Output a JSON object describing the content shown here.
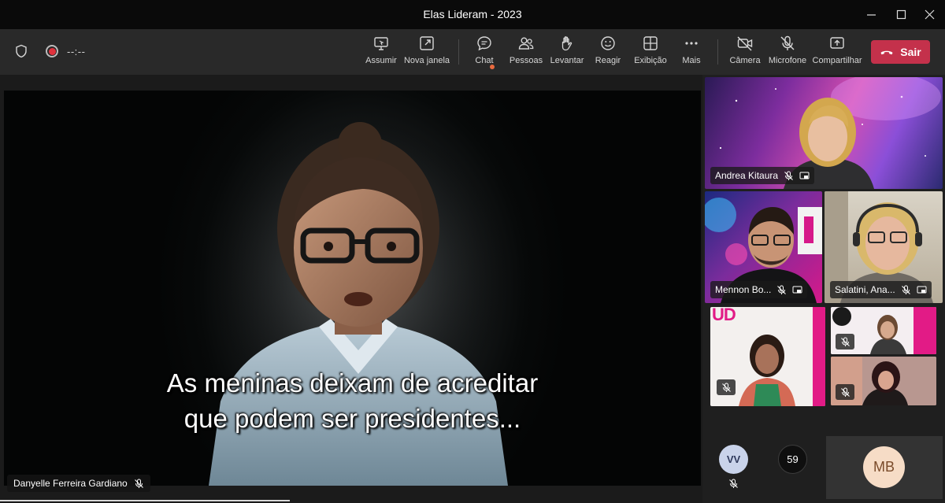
{
  "window": {
    "title": "Elas Lideram - 2023"
  },
  "toolbar": {
    "timer": "--:--",
    "items": [
      {
        "label": "Assumir",
        "icon": "share-screen-take-control-icon"
      },
      {
        "label": "Nova janela",
        "icon": "pop-out-icon"
      },
      {
        "label": "Chat",
        "icon": "chat-icon"
      },
      {
        "label": "Pessoas",
        "icon": "people-icon"
      },
      {
        "label": "Levantar",
        "icon": "raise-hand-icon"
      },
      {
        "label": "Reagir",
        "icon": "smiley-icon"
      },
      {
        "label": "Exibição",
        "icon": "grid-view-icon"
      },
      {
        "label": "Mais",
        "icon": "more-icon"
      },
      {
        "label": "Câmera",
        "icon": "camera-off-icon"
      },
      {
        "label": "Microfone",
        "icon": "mic-off-icon"
      },
      {
        "label": "Compartilhar",
        "icon": "share-tray-icon"
      }
    ],
    "leave_label": "Sair"
  },
  "main_video": {
    "subtitle_line1": "As meninas deixam de acreditar",
    "subtitle_line2": "que podem ser presidentes...",
    "presenter_name": "Danyelle Ferreira Gardiano"
  },
  "participants": [
    {
      "name": "Andrea Kitaura"
    },
    {
      "name": "Mennon Bo..."
    },
    {
      "name": "Salatini, Ana..."
    }
  ],
  "tile_logo_text": "UD",
  "overflow": {
    "avatar_initials": "VV",
    "more_count": "59",
    "mb_initials": "MB"
  },
  "colors": {
    "leave": "#c4314b",
    "recording": "#e0323d",
    "avatar_vv": "#c9d3ea",
    "avatar_mb": "#f6dcc6"
  }
}
